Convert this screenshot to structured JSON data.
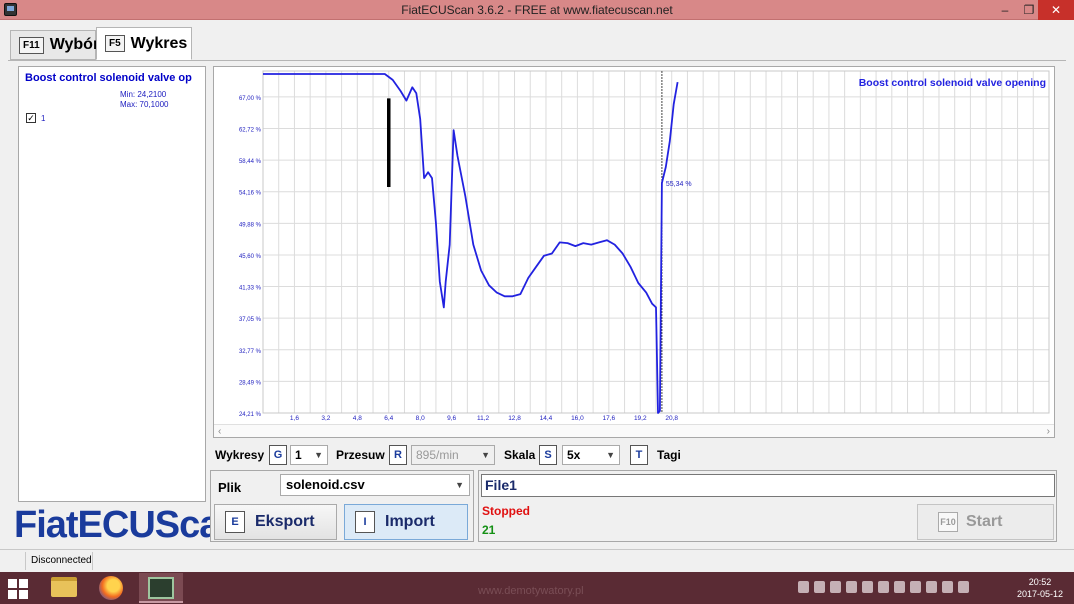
{
  "window": {
    "title": "FiatECUScan 3.6.2 - FREE at www.fiatecuscan.net",
    "min_glyph": "–",
    "max_glyph": "❐",
    "close_glyph": "✕"
  },
  "tabs": [
    {
      "key": "F11",
      "label": "Wybór",
      "active": false
    },
    {
      "key": "F5",
      "label": "Wykres",
      "active": true
    }
  ],
  "left_panel": {
    "channel_name": "Boost control solenoid valve op",
    "min_text": "Min: 24,2100",
    "max_text": "Max: 70,1000",
    "checkbox_checked": true,
    "checkbox_mark": "✓",
    "checkbox_label": "1"
  },
  "logo": {
    "text": "FiatECUScan"
  },
  "chart_data": {
    "type": "line",
    "title": "Boost control solenoid valve opening",
    "xlabel": "",
    "ylabel": "",
    "x_ticks": [
      "1,6",
      "3,2",
      "4,8",
      "6,4",
      "8,0",
      "9,6",
      "11,2",
      "12,8",
      "14,4",
      "16,0",
      "17,6",
      "19,2",
      "20,8"
    ],
    "x_tick_values": [
      1.6,
      3.2,
      4.8,
      6.4,
      8.0,
      9.6,
      11.2,
      12.8,
      14.4,
      16.0,
      17.6,
      19.2,
      20.8
    ],
    "y_ticks": [
      "24,21 %",
      "28,49 %",
      "32,77 %",
      "37,05 %",
      "41,33 %",
      "45,60 %",
      "49,88 %",
      "54,16 %",
      "58,44 %",
      "62,72 %",
      "67,00 %"
    ],
    "y_tick_values": [
      24.21,
      28.49,
      32.77,
      37.05,
      41.33,
      45.6,
      49.88,
      54.16,
      58.44,
      62.72,
      67.0
    ],
    "xlim": [
      0,
      40
    ],
    "ylim": [
      24.21,
      70.5
    ],
    "grid": true,
    "cursor_x": 20.3,
    "cursor_label": "55,34 %",
    "series": [
      {
        "name": "Boost control solenoid valve opening",
        "color": "#2222e0",
        "x": [
          0.0,
          0.8,
          1.6,
          2.4,
          3.2,
          4.0,
          4.8,
          5.6,
          6.2,
          6.6,
          7.0,
          7.3,
          7.6,
          7.8,
          8.0,
          8.2,
          8.4,
          8.6,
          8.8,
          9.0,
          9.2,
          9.3,
          9.5,
          9.7,
          9.9,
          10.3,
          10.7,
          11.1,
          11.5,
          11.9,
          12.3,
          12.7,
          13.1,
          13.5,
          13.9,
          14.3,
          14.7,
          15.1,
          15.5,
          15.9,
          16.3,
          16.7,
          17.1,
          17.5,
          17.9,
          18.3,
          18.7,
          19.1,
          19.5,
          19.8,
          20.0,
          20.1,
          20.2,
          20.3,
          20.5,
          20.7,
          20.9,
          21.1
        ],
        "y": [
          70.1,
          70.1,
          70.1,
          70.1,
          70.1,
          70.1,
          70.1,
          70.1,
          70.1,
          69.3,
          67.8,
          66.5,
          68.3,
          67.5,
          64.0,
          56.0,
          56.8,
          56.0,
          50.0,
          42.0,
          38.5,
          42.0,
          47.0,
          62.5,
          59.0,
          53.5,
          47.0,
          43.5,
          41.5,
          40.5,
          40.0,
          40.0,
          40.3,
          42.5,
          44.0,
          45.5,
          45.8,
          47.3,
          47.2,
          46.8,
          47.2,
          47.0,
          47.3,
          47.6,
          47.0,
          45.8,
          44.0,
          41.8,
          40.5,
          39.0,
          38.5,
          24.21,
          24.5,
          55.34,
          57.5,
          61.0,
          66.0,
          69.0
        ]
      }
    ],
    "marker_bar": {
      "x": 6.4,
      "y_low": 54.8,
      "y_high": 66.8,
      "color": "#000000"
    }
  },
  "controls": {
    "wykresy_label": "Wykresy",
    "wykresy_key": "G",
    "wykresy_value": "1",
    "przesuw_label": "Przesuw",
    "przesuw_key": "R",
    "przesuw_value": "895/min",
    "skala_label": "Skala",
    "skala_key": "S",
    "skala_value": "5x",
    "tagi_key": "T",
    "tagi_label": "Tagi",
    "dropdown_glyph": "▼"
  },
  "file_panel": {
    "plik_label": "Plik",
    "plik_value": "solenoid.csv",
    "eksport_key": "E",
    "eksport_label": "Eksport",
    "import_key": "I",
    "import_label": "Import"
  },
  "status_panel": {
    "file_name": "File1",
    "state_text": "Stopped",
    "count_text": "21",
    "start_key": "F10",
    "start_label": "Start"
  },
  "statusbar": {
    "connection": "Disconnected"
  },
  "taskbar": {
    "watermark": "www.demotywatory.pl",
    "time": "20:52",
    "date": "2017-05-12"
  }
}
